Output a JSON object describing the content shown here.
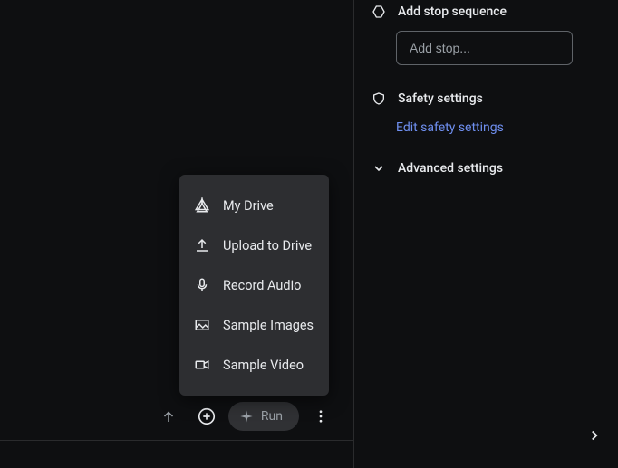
{
  "sidebar": {
    "stop_sequence": {
      "label": "Add stop sequence",
      "placeholder": "Add stop..."
    },
    "safety": {
      "label": "Safety settings",
      "link": "Edit safety settings"
    },
    "advanced": {
      "label": "Advanced settings"
    }
  },
  "bottom": {
    "run_label": "Run"
  },
  "menu": {
    "items": [
      {
        "label": "My Drive"
      },
      {
        "label": "Upload to Drive"
      },
      {
        "label": "Record Audio"
      },
      {
        "label": "Sample Images"
      },
      {
        "label": "Sample Video"
      }
    ]
  }
}
